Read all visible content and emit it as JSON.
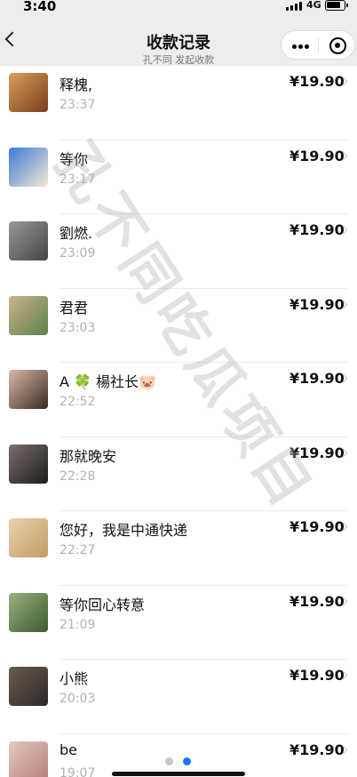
{
  "status_bar": {
    "time": "3:40",
    "network": "4G"
  },
  "nav": {
    "title": "收款记录",
    "subtitle": "孔不同 发起收款"
  },
  "watermark": "孔不同吃瓜项目",
  "records": [
    {
      "name": "释槐,",
      "time": "23:37",
      "amount": "¥19.90"
    },
    {
      "name": "等你",
      "time": "23:17",
      "amount": "¥19.90"
    },
    {
      "name": "劉燃.",
      "time": "23:09",
      "amount": "¥19.90"
    },
    {
      "name": "君君",
      "time": "23:03",
      "amount": "¥19.90"
    },
    {
      "name": "A 🍀 楊社长🐷",
      "time": "22:52",
      "amount": "¥19.90"
    },
    {
      "name": "那就晚安",
      "time": "22:28",
      "amount": "¥19.90"
    },
    {
      "name": "您好，我是中通快递",
      "time": "22:27",
      "amount": "¥19.90"
    },
    {
      "name": "等你回心转意",
      "time": "21:09",
      "amount": "¥19.90"
    },
    {
      "name": "小熊",
      "time": "20:03",
      "amount": "¥19.90"
    },
    {
      "name": "be",
      "time": "19:07",
      "amount": "¥19.90"
    }
  ],
  "pager": {
    "pages": 2,
    "active_page": 2
  },
  "colors": {
    "nav_bg": "#ededed",
    "pager_active": "#1677ff",
    "pager_inactive": "#c8c8c8"
  }
}
